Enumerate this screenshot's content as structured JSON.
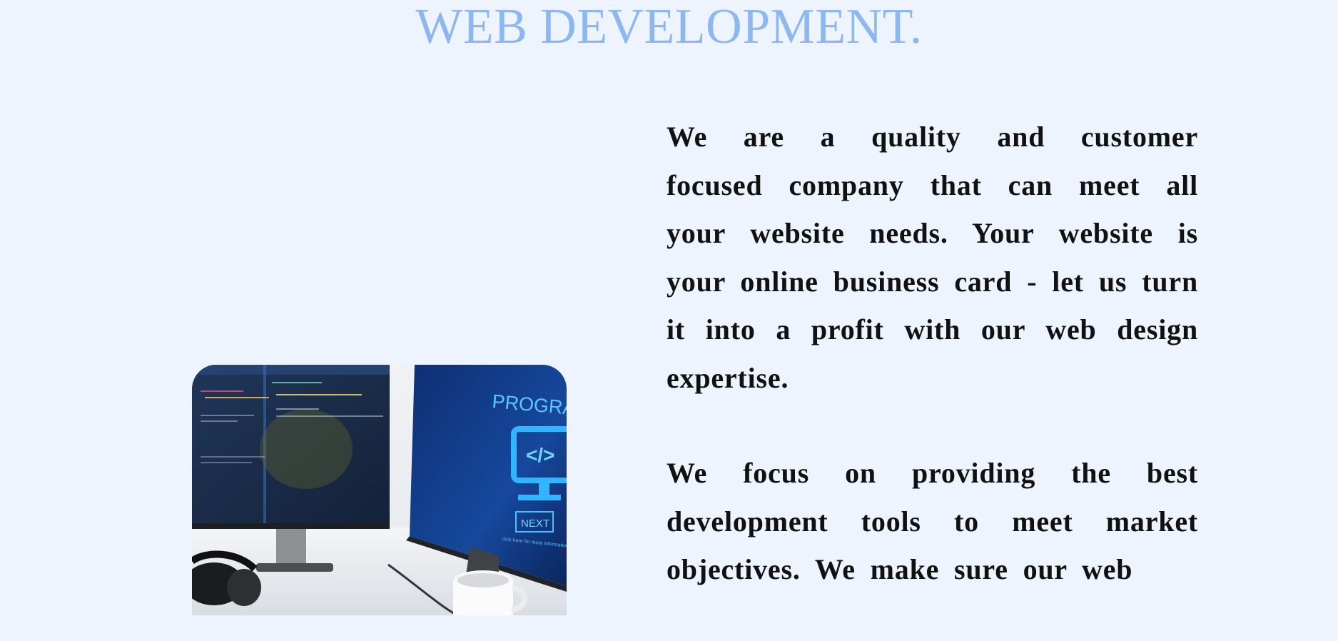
{
  "page": {
    "title": "WEB DEVELOPMENT."
  },
  "hero_image": {
    "screen_title": "PROGRAM",
    "code_symbol": "</>",
    "button_label": "NEXT",
    "caption": "click here for more information"
  },
  "content": {
    "paragraphs": [
      "We are a quality and customer focused company that can meet all your website needs. Your website is your online business card - let us turn it into a profit with our web design expertise.",
      "We focus on providing the best development tools to meet market objectives. We make sure our web"
    ]
  },
  "colors": {
    "background": "#eef4fe",
    "title": "#8db7ef",
    "body_text": "#111111",
    "screen_blue": "#1d4fa5",
    "screen_accent": "#2aa8ff"
  }
}
